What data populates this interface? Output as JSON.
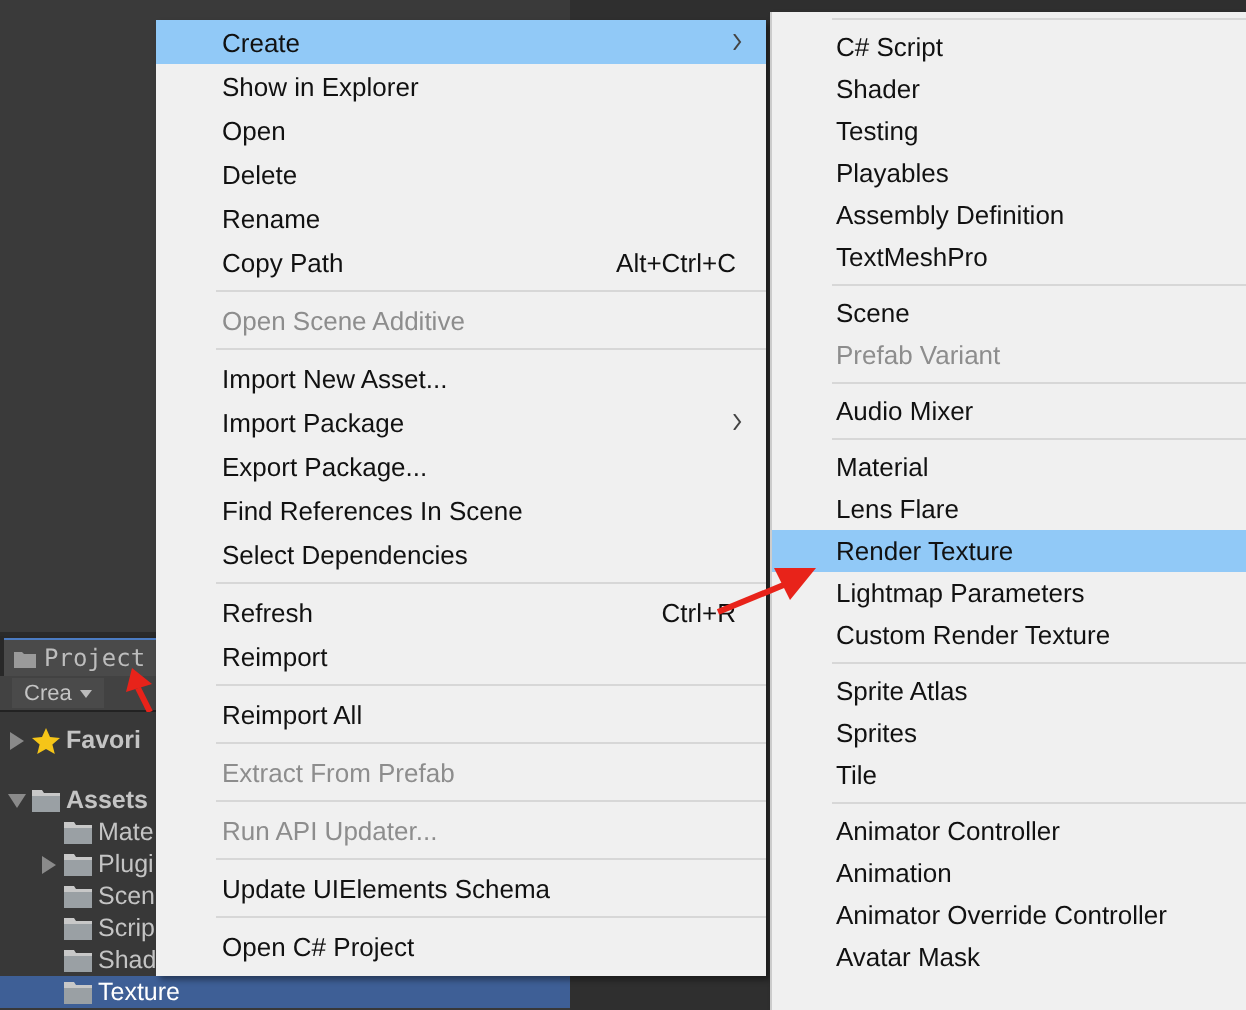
{
  "project_panel": {
    "tab": {
      "label": "Project",
      "selected": true
    },
    "create_button": "Crea",
    "tree": [
      {
        "label": "Favori",
        "kind": "star",
        "expanded": false,
        "selected": false
      },
      {
        "label": "Assets",
        "kind": "folder",
        "expanded": true,
        "selected": false,
        "children": [
          {
            "label": "Mate",
            "kind": "folder",
            "selected": false
          },
          {
            "label": "Plugi",
            "kind": "folder",
            "expanded": false,
            "selected": false
          },
          {
            "label": "Scen",
            "kind": "folder",
            "selected": false
          },
          {
            "label": "Scrip",
            "kind": "folder",
            "selected": false
          },
          {
            "label": "Shad",
            "kind": "folder",
            "selected": false
          },
          {
            "label": "Texture",
            "kind": "folder",
            "selected": true
          }
        ]
      }
    ]
  },
  "context_menu": [
    {
      "kind": "item",
      "label": "Create",
      "submenu": true,
      "selected": true,
      "disabled": false
    },
    {
      "kind": "item",
      "label": "Show in Explorer",
      "submenu": false,
      "selected": false,
      "disabled": false
    },
    {
      "kind": "item",
      "label": "Open",
      "submenu": false,
      "selected": false,
      "disabled": false
    },
    {
      "kind": "item",
      "label": "Delete",
      "submenu": false,
      "selected": false,
      "disabled": false
    },
    {
      "kind": "item",
      "label": "Rename",
      "submenu": false,
      "selected": false,
      "disabled": false
    },
    {
      "kind": "item",
      "label": "Copy Path",
      "shortcut": "Alt+Ctrl+C",
      "submenu": false,
      "selected": false,
      "disabled": false
    },
    {
      "kind": "separator"
    },
    {
      "kind": "item",
      "label": "Open Scene Additive",
      "submenu": false,
      "selected": false,
      "disabled": true
    },
    {
      "kind": "separator"
    },
    {
      "kind": "item",
      "label": "Import New Asset...",
      "submenu": false,
      "selected": false,
      "disabled": false
    },
    {
      "kind": "item",
      "label": "Import Package",
      "submenu": true,
      "selected": false,
      "disabled": false
    },
    {
      "kind": "item",
      "label": "Export Package...",
      "submenu": false,
      "selected": false,
      "disabled": false
    },
    {
      "kind": "item",
      "label": "Find References In Scene",
      "submenu": false,
      "selected": false,
      "disabled": false
    },
    {
      "kind": "item",
      "label": "Select Dependencies",
      "submenu": false,
      "selected": false,
      "disabled": false
    },
    {
      "kind": "separator"
    },
    {
      "kind": "item",
      "label": "Refresh",
      "shortcut": "Ctrl+R",
      "submenu": false,
      "selected": false,
      "disabled": false
    },
    {
      "kind": "item",
      "label": "Reimport",
      "submenu": false,
      "selected": false,
      "disabled": false
    },
    {
      "kind": "separator"
    },
    {
      "kind": "item",
      "label": "Reimport All",
      "submenu": false,
      "selected": false,
      "disabled": false
    },
    {
      "kind": "separator"
    },
    {
      "kind": "item",
      "label": "Extract From Prefab",
      "submenu": false,
      "selected": false,
      "disabled": true
    },
    {
      "kind": "separator"
    },
    {
      "kind": "item",
      "label": "Run API Updater...",
      "submenu": false,
      "selected": false,
      "disabled": true
    },
    {
      "kind": "separator"
    },
    {
      "kind": "item",
      "label": "Update UIElements Schema",
      "submenu": false,
      "selected": false,
      "disabled": false
    },
    {
      "kind": "separator"
    },
    {
      "kind": "item",
      "label": "Open C# Project",
      "submenu": false,
      "selected": false,
      "disabled": false
    }
  ],
  "create_submenu": [
    {
      "kind": "separator"
    },
    {
      "kind": "item",
      "label": "C# Script",
      "selected": false,
      "disabled": false
    },
    {
      "kind": "item",
      "label": "Shader",
      "selected": false,
      "disabled": false
    },
    {
      "kind": "item",
      "label": "Testing",
      "selected": false,
      "disabled": false
    },
    {
      "kind": "item",
      "label": "Playables",
      "selected": false,
      "disabled": false
    },
    {
      "kind": "item",
      "label": "Assembly Definition",
      "selected": false,
      "disabled": false
    },
    {
      "kind": "item",
      "label": "TextMeshPro",
      "selected": false,
      "disabled": false
    },
    {
      "kind": "separator"
    },
    {
      "kind": "item",
      "label": "Scene",
      "selected": false,
      "disabled": false
    },
    {
      "kind": "item",
      "label": "Prefab Variant",
      "selected": false,
      "disabled": true
    },
    {
      "kind": "separator"
    },
    {
      "kind": "item",
      "label": "Audio Mixer",
      "selected": false,
      "disabled": false
    },
    {
      "kind": "separator"
    },
    {
      "kind": "item",
      "label": "Material",
      "selected": false,
      "disabled": false
    },
    {
      "kind": "item",
      "label": "Lens Flare",
      "selected": false,
      "disabled": false
    },
    {
      "kind": "item",
      "label": "Render Texture",
      "selected": true,
      "disabled": false
    },
    {
      "kind": "item",
      "label": "Lightmap Parameters",
      "selected": false,
      "disabled": false
    },
    {
      "kind": "item",
      "label": "Custom Render Texture",
      "selected": false,
      "disabled": false
    },
    {
      "kind": "separator"
    },
    {
      "kind": "item",
      "label": "Sprite Atlas",
      "selected": false,
      "disabled": false
    },
    {
      "kind": "item",
      "label": "Sprites",
      "selected": false,
      "disabled": false
    },
    {
      "kind": "item",
      "label": "Tile",
      "selected": false,
      "disabled": false
    },
    {
      "kind": "separator"
    },
    {
      "kind": "item",
      "label": "Animator Controller",
      "selected": false,
      "disabled": false
    },
    {
      "kind": "item",
      "label": "Animation",
      "selected": false,
      "disabled": false
    },
    {
      "kind": "item",
      "label": "Animator Override Controller",
      "selected": false,
      "disabled": false
    },
    {
      "kind": "item",
      "label": "Avatar Mask",
      "selected": false,
      "disabled": false
    }
  ]
}
